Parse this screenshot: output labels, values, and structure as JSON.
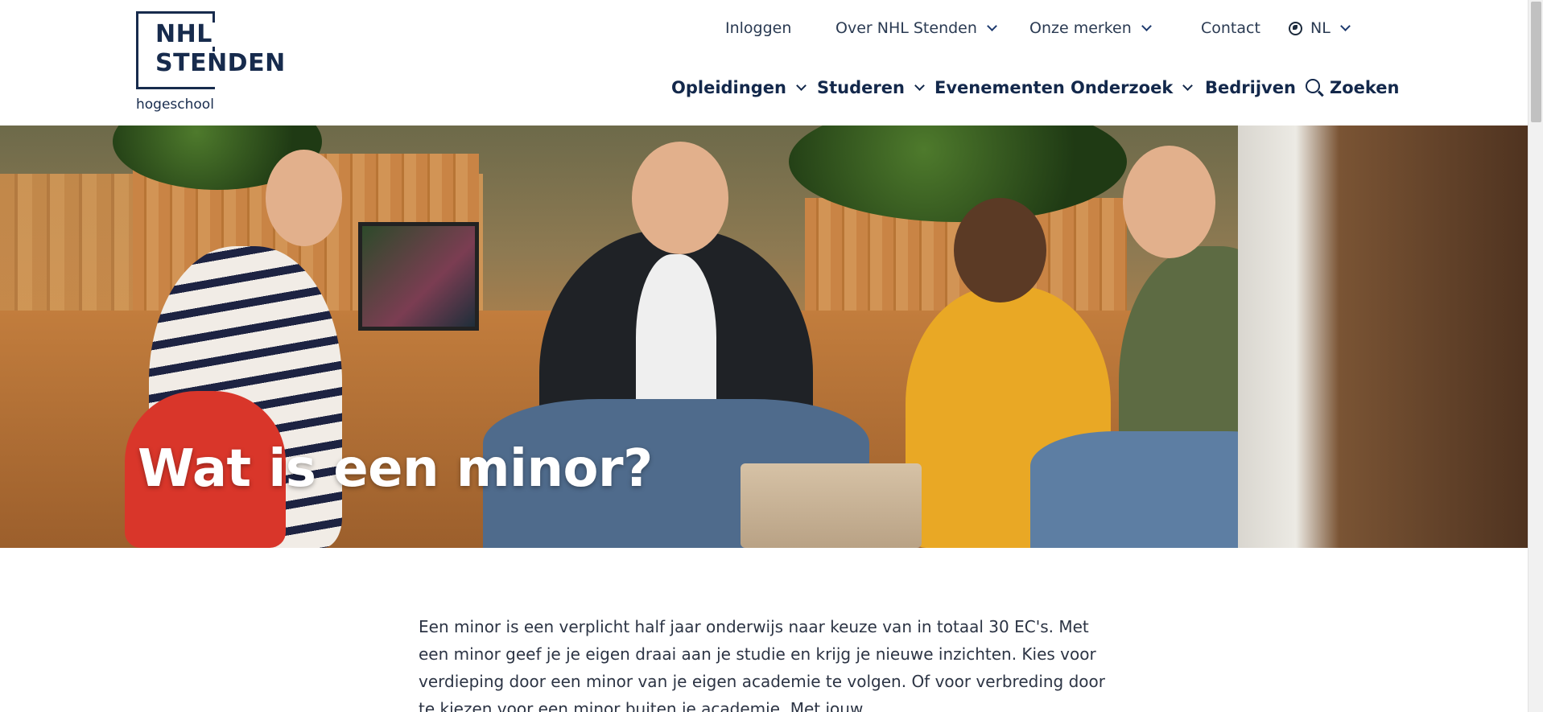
{
  "logo": {
    "line1": "NHL",
    "line2": "STENDEN",
    "sub": "hogeschool"
  },
  "topnav": {
    "login": "Inloggen",
    "about": "Over NHL Stenden",
    "brands": "Onze merken",
    "contact": "Contact",
    "lang": "NL"
  },
  "mainnav": {
    "programs": "Opleidingen",
    "study": "Studeren",
    "events": "Evenementen",
    "research": "Onderzoek",
    "companies": "Bedrijven",
    "search": "Zoeken"
  },
  "hero": {
    "title": "Wat is een minor?"
  },
  "content": {
    "intro": "Een minor is een verplicht half jaar onderwijs naar keuze van in totaal 30 EC's. Met een minor geef je je eigen draai aan je studie en krijg je nieuwe inzichten. Kies voor verdieping door een minor van je eigen academie te volgen. Of voor verbreding door te kiezen voor een minor buiten je academie. Met jouw"
  },
  "colors": {
    "brand_navy": "#13284b",
    "text": "#2c3444",
    "background": "#ffffff"
  },
  "icons": [
    "chevron-down-icon",
    "globe-icon",
    "search-icon"
  ]
}
